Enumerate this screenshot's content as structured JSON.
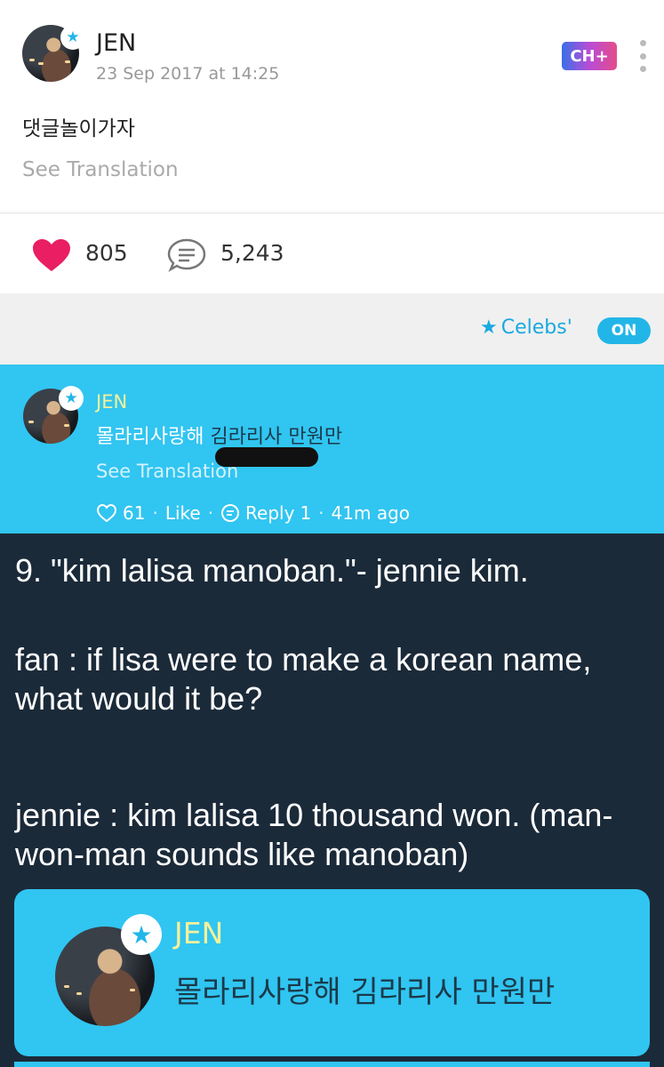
{
  "post": {
    "author": "JEN",
    "date": "23 Sep 2017 at 14:25",
    "channel_badge": "CH+",
    "body": "댓글놀이가자",
    "see_translation": "See Translation",
    "likes": "805",
    "comments": "5,243"
  },
  "filter": {
    "celebs_label": "Celebs'",
    "toggle": "ON"
  },
  "comment": {
    "author": "JEN",
    "body_a": "몰라리사랑해",
    "body_b": "김라리사 만원만",
    "see_translation": "See Translation",
    "likes": "61",
    "like_label": "Like",
    "reply_label": "Reply",
    "reply_count": "1",
    "time": "41m ago"
  },
  "tweet": {
    "line1": "9. \"kim lalisa manoban.\"- jennie kim.",
    "line2": "fan : if lisa were to make a korean name, what would it be?",
    "line3": "jennie : kim lalisa 10 thousand won. (man-won-man sounds like manoban)",
    "embed": {
      "author": "JEN",
      "body": "몰라리사랑해 김라리사 만원만"
    }
  },
  "colors": {
    "accent": "#22b6e8",
    "comment_bg": "#31c5f1",
    "tweet_bg": "#1b2a39",
    "heart": "#e91e63"
  }
}
